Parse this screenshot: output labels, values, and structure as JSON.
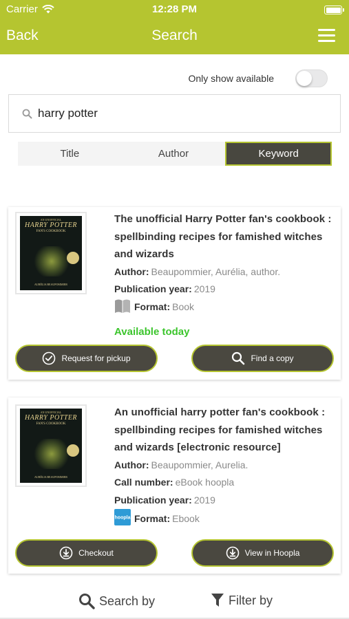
{
  "status_bar": {
    "carrier": "Carrier",
    "time": "12:28 PM"
  },
  "nav": {
    "back_label": "Back",
    "title": "Search",
    "menu_icon": "hamburger-menu-icon"
  },
  "filter": {
    "only_available_label": "Only show available",
    "only_available": false
  },
  "search": {
    "query": "harry potter",
    "icon": "search-icon"
  },
  "segments": [
    {
      "label": "Title",
      "active": false
    },
    {
      "label": "Author",
      "active": false
    },
    {
      "label": "Keyword",
      "active": true
    }
  ],
  "results": [
    {
      "title": "The unofficial Harry Potter fan's cookbook : spellbinding recipes for famished witches and wizards",
      "author_label": "Author:",
      "author": "Beaupommier, Aurélia, author.",
      "year_label": "Publication year:",
      "year": "2019",
      "format_label": "Format:",
      "format": "Book",
      "format_icon": "book-icon",
      "availability": "Available today",
      "buttons": [
        {
          "label": "Request for pickup",
          "icon": "check-circle-icon"
        },
        {
          "label": "Find a copy",
          "icon": "search-icon"
        }
      ]
    },
    {
      "title": "An unofficial harry potter fan's cookbook : spellbinding recipes for famished witches and wizards [electronic resource]",
      "author_label": "Author:",
      "author": "Beaupommier, Aurelia.",
      "call_label": "Call number:",
      "call_number": "eBook hoopla",
      "year_label": "Publication year:",
      "year": "2019",
      "format_label": "Format:",
      "format": "Ebook",
      "format_icon": "hoopla-icon",
      "format_icon_text": "hoopla",
      "buttons": [
        {
          "label": "Checkout",
          "icon": "download-circle-icon"
        },
        {
          "label": "View in Hoopla",
          "icon": "download-circle-icon"
        }
      ]
    }
  ],
  "cover": {
    "line1": "AN UNOFFICIAL",
    "line2": "HARRY POTTER",
    "line3": "FAN'S COOKBOOK",
    "line4": "AURÉLIA BEAUPOMMIER"
  },
  "bottom_bar": {
    "search_by": "Search by",
    "filter_by": "Filter by"
  },
  "colors": {
    "accent": "#b5c530",
    "button_bg": "#4a4840",
    "available": "#3cc52d",
    "hoopla": "#2e9bd6"
  }
}
